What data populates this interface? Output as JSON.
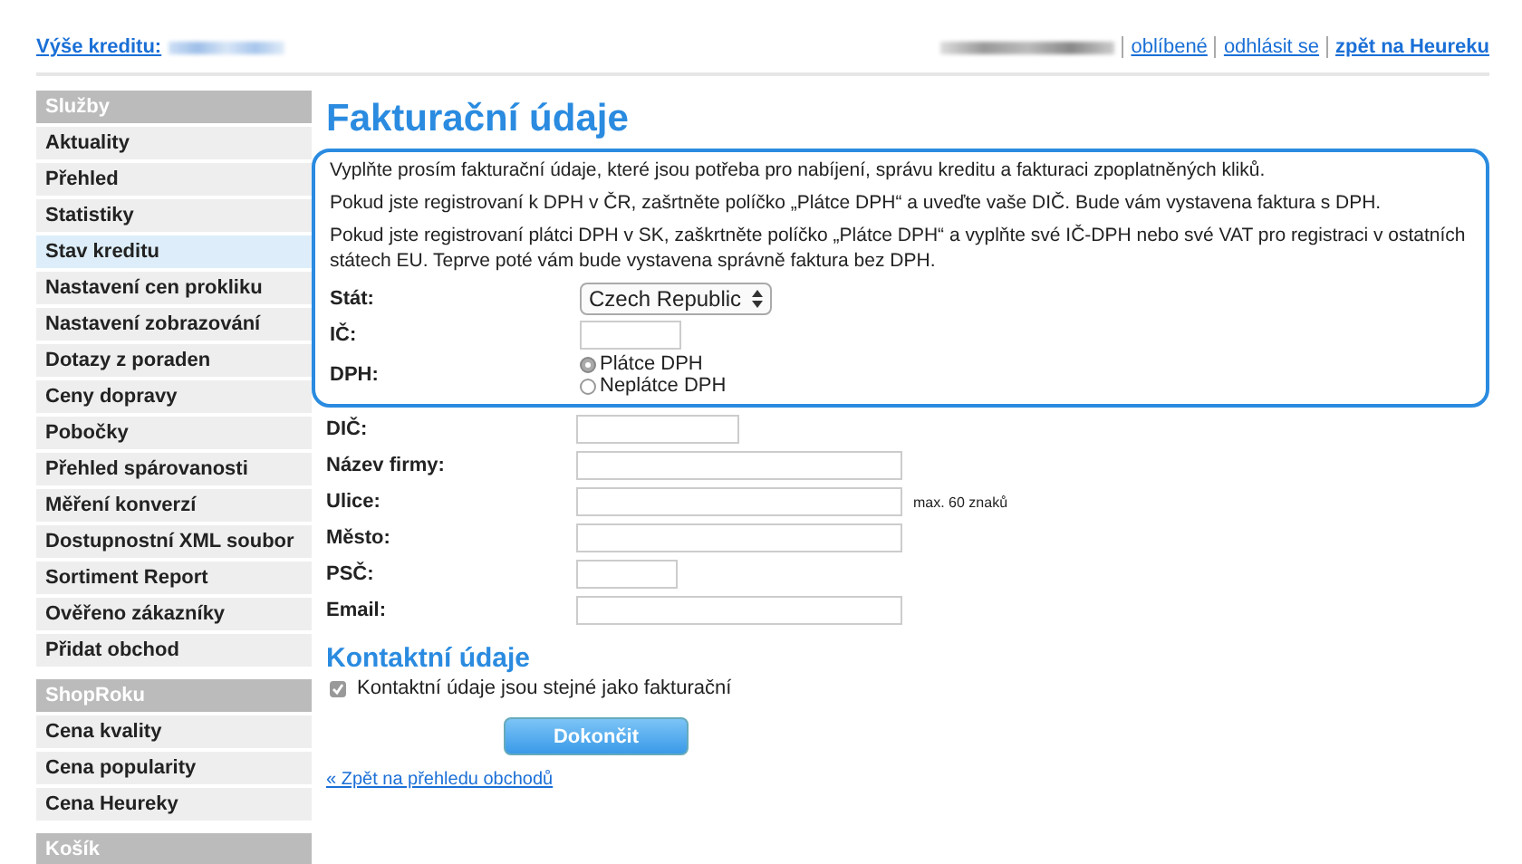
{
  "top_bar": {
    "credit_label": "Výše kreditu:",
    "links": [
      {
        "label": "oblíbené",
        "bold": false
      },
      {
        "label": "odhlásit se",
        "bold": false
      },
      {
        "label": "zpět na Heureku",
        "bold": true
      }
    ]
  },
  "sidebar": [
    {
      "heading": "Služby",
      "items": [
        {
          "label": "Aktuality",
          "selected": false
        },
        {
          "label": "Přehled",
          "selected": false
        },
        {
          "label": "Statistiky",
          "selected": false
        },
        {
          "label": "Stav kreditu",
          "selected": true
        },
        {
          "label": "Nastavení cen prokliku",
          "selected": false
        },
        {
          "label": "Nastavení zobrazování",
          "selected": false
        },
        {
          "label": "Dotazy z poraden",
          "selected": false
        },
        {
          "label": "Ceny dopravy",
          "selected": false
        },
        {
          "label": "Pobočky",
          "selected": false
        },
        {
          "label": "Přehled spárovanosti",
          "selected": false
        },
        {
          "label": "Měření konverzí",
          "selected": false
        },
        {
          "label": "Dostupnostní XML soubor",
          "selected": false
        },
        {
          "label": "Sortiment Report",
          "selected": false
        },
        {
          "label": "Ověřeno zákazníky",
          "selected": false
        },
        {
          "label": "Přidat obchod",
          "selected": false
        }
      ]
    },
    {
      "heading": "ShopRoku",
      "items": [
        {
          "label": "Cena kvality",
          "selected": false
        },
        {
          "label": "Cena popularity",
          "selected": false
        },
        {
          "label": "Cena Heureky",
          "selected": false
        }
      ]
    },
    {
      "heading": "Košík"
    }
  ],
  "title": "Fakturační údaje",
  "notes": [
    "Vyplňte prosím fakturační údaje, které jsou potřeba pro nabíjení, správu kreditu a fakturaci zpoplatněných kliků.",
    "Pokud jste registrovaní k DPH v ČR, zašrtněte políčko „Plátce DPH“ a uveďte vaše DIČ. Bude vám vystavena faktura s DPH.",
    "Pokud jste registrovaní plátci DPH v SK, zaškrtněte políčko „Plátce DPH“ a vyplňte své IČ-DPH nebo své VAT pro registraci v ostatních státech EU. Teprve poté vám bude vystavena správně faktura bez DPH."
  ],
  "highlighted_fields": [
    {
      "kind": "select",
      "label": "Stát:",
      "value": "Czech Republic"
    },
    {
      "kind": "text",
      "label": "IČ:"
    },
    {
      "kind": "radio",
      "label": "DPH:",
      "options": [
        {
          "label": "Plátce DPH",
          "selected": true
        },
        {
          "label": "Neplátce DPH",
          "selected": false
        }
      ]
    }
  ],
  "fields": [
    {
      "kind": "text",
      "label": "DIČ:"
    },
    {
      "kind": "text",
      "label": "Název firmy:"
    },
    {
      "kind": "text",
      "label": "Ulice:",
      "hint": "max. 60 znaků"
    },
    {
      "kind": "text",
      "label": "Město:"
    },
    {
      "kind": "text",
      "label": "PSČ:"
    },
    {
      "kind": "text",
      "label": "Email:"
    }
  ],
  "contact": {
    "heading": "Kontaktní údaje",
    "checkbox": {
      "label": "Kontaktní údaje jsou stejné jako fakturační",
      "checked": true
    }
  },
  "submit": "Dokončit",
  "back_link": "« Zpět na přehledu obchodů"
}
